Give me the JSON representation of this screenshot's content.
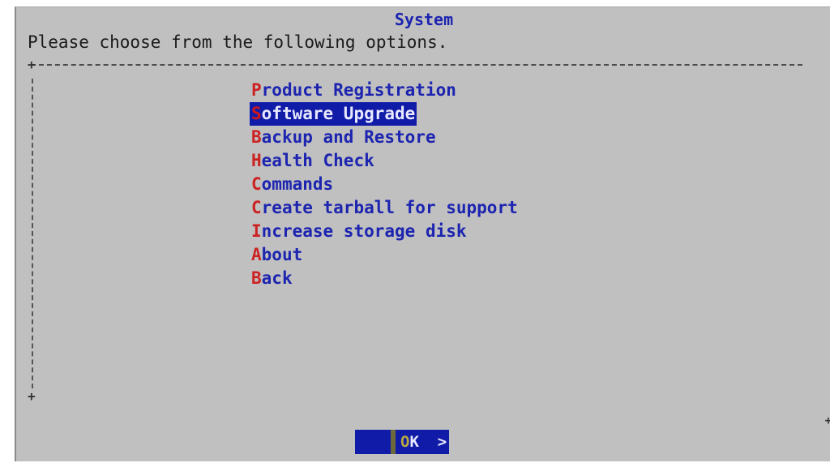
{
  "dialog": {
    "title": "System",
    "prompt": "Please choose from the following options."
  },
  "menu": {
    "items": [
      {
        "hotkey": "P",
        "rest": "roduct Registration",
        "selected": false
      },
      {
        "hotkey": "S",
        "rest": "oftware Upgrade",
        "selected": true
      },
      {
        "hotkey": "B",
        "rest": "ackup and Restore",
        "selected": false
      },
      {
        "hotkey": "H",
        "rest": "ealth Check",
        "selected": false
      },
      {
        "hotkey": "C",
        "rest": "ommands",
        "selected": false
      },
      {
        "hotkey": "C",
        "rest": "reate tarball for support",
        "selected": false
      },
      {
        "hotkey": "I",
        "rest": "ncrease storage disk",
        "selected": false
      },
      {
        "hotkey": "A",
        "rest": "bout",
        "selected": false
      },
      {
        "hotkey": "B",
        "rest": "ack",
        "selected": false
      }
    ]
  },
  "buttons": {
    "ok_open": "< ",
    "ok_hotkey": "O",
    "ok_rest": "K  >",
    "left_label": "<"
  },
  "colors": {
    "background": "#c0c0c0",
    "accent_blue": "#1c24b0",
    "hotkey_red": "#cc2222",
    "selection_bg": "#101ba8"
  }
}
